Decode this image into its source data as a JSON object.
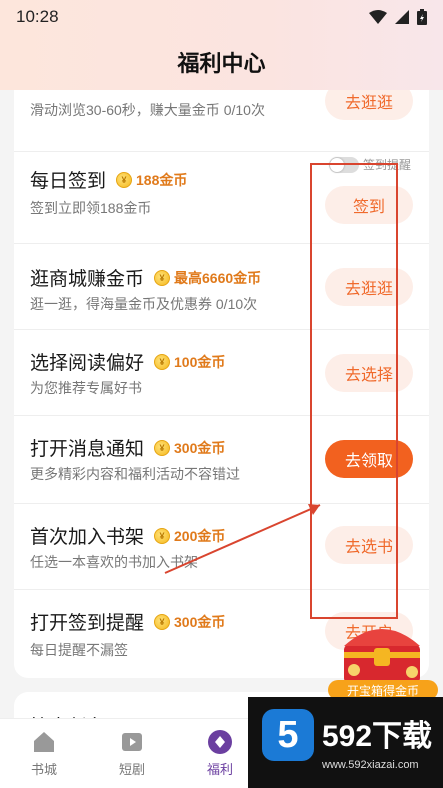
{
  "status_bar": {
    "time": "10:28"
  },
  "header": {
    "title": "福利中心"
  },
  "tasks": [
    {
      "title": "",
      "reward": "",
      "desc": "滑动浏览30-60秒，赚大量金币 0/10次",
      "button": "去逛逛"
    },
    {
      "title": "每日签到",
      "reward": "188金币",
      "desc": "签到立即领188金币",
      "button": "签到",
      "toggle_label": "签到提醒"
    },
    {
      "title": "逛商城赚金币",
      "reward": "最高6660金币",
      "desc": "逛一逛，得海量金币及优惠券 0/10次",
      "button": "去逛逛"
    },
    {
      "title": "选择阅读偏好",
      "reward": "100金币",
      "desc": "为您推荐专属好书",
      "button": "去选择"
    },
    {
      "title": "打开消息通知",
      "reward": "300金币",
      "desc": "更多精彩内容和福利活动不容错过",
      "button": "去领取"
    },
    {
      "title": "首次加入书架",
      "reward": "200金币",
      "desc": "任选一本喜欢的书加入书架",
      "button": "去选书"
    },
    {
      "title": "打开签到提醒",
      "reward": "300金币",
      "desc": "每日提醒不漏签",
      "button": "去开启"
    }
  ],
  "section2": {
    "title": "惊喜任务"
  },
  "treasure": {
    "label": "开宝箱得金币"
  },
  "tabs": [
    {
      "label": "书城",
      "icon": "home-icon"
    },
    {
      "label": "短剧",
      "icon": "play-icon"
    },
    {
      "label": "福利",
      "icon": "welfare-icon"
    }
  ],
  "watermark": {
    "logo": "5",
    "title": "592下载",
    "url": "www.592xiazai.com"
  },
  "colors": {
    "accent": "#f2611f",
    "reward": "#e07a1b",
    "tab_active": "#6b3fa0",
    "annotation": "#d9452f"
  }
}
